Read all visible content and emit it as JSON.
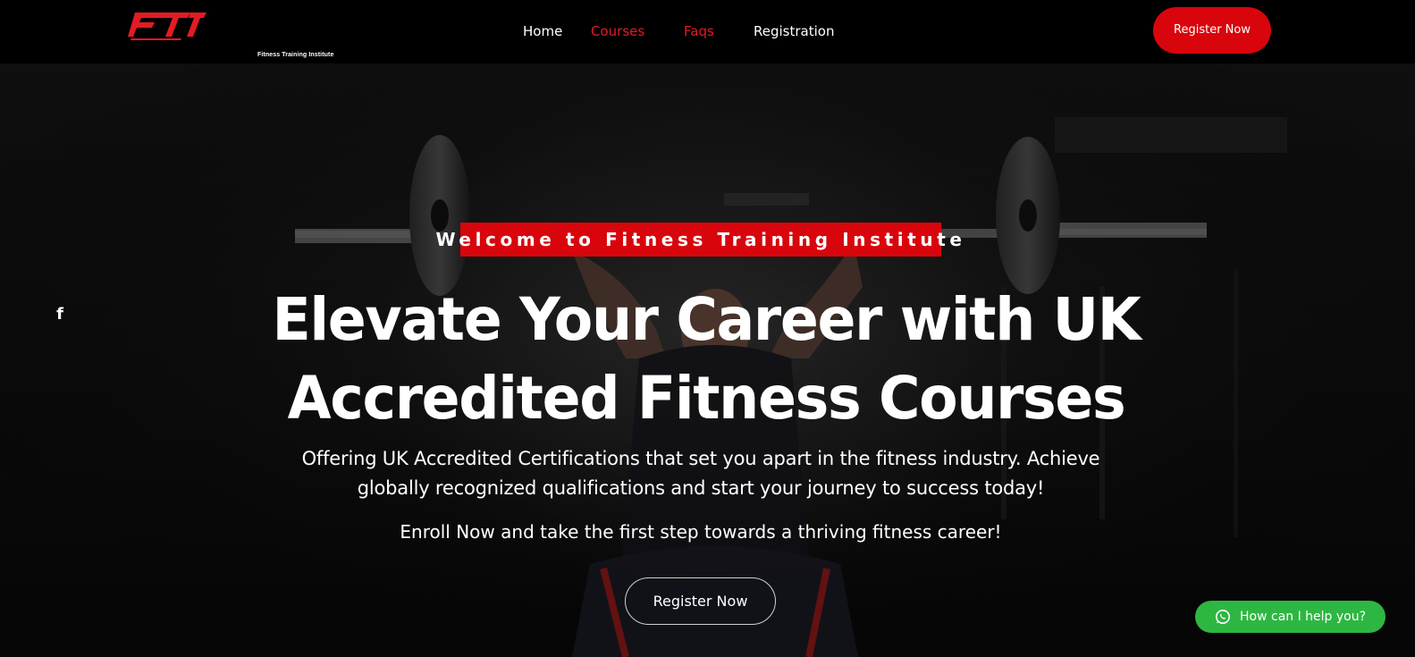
{
  "header": {
    "logo": {
      "letters": "FTI",
      "tagline": "Fitness Training Institute",
      "color": "#e31b23"
    },
    "nav": [
      {
        "label": "Home",
        "active": false
      },
      {
        "label": "Courses",
        "active": true
      },
      {
        "label": "Faqs",
        "active": true
      },
      {
        "label": "Registration",
        "active": false
      }
    ],
    "cta_label": "Register Now"
  },
  "social": {
    "facebook": "f"
  },
  "hero": {
    "badge": "Welcome to Fitness Training Institute",
    "title_lines": [
      "Elevate Your Career with UK",
      "Accredited Fitness Courses"
    ],
    "subtitle_lines": [
      "Offering UK Accredited Certifications that set you apart in the fitness industry. Achieve",
      "globally recognized qualifications and start your journey to success today!"
    ],
    "enroll_text": "Enroll Now and take the first step towards a thriving fitness career!",
    "cta_label": "Register Now"
  },
  "chat": {
    "label": "How can I help you?",
    "icon": "whatsapp-icon"
  },
  "colors": {
    "brand_red": "#d8050c",
    "nav_active": "#e31b23",
    "chat_green": "#2db742",
    "background": "#000000"
  }
}
